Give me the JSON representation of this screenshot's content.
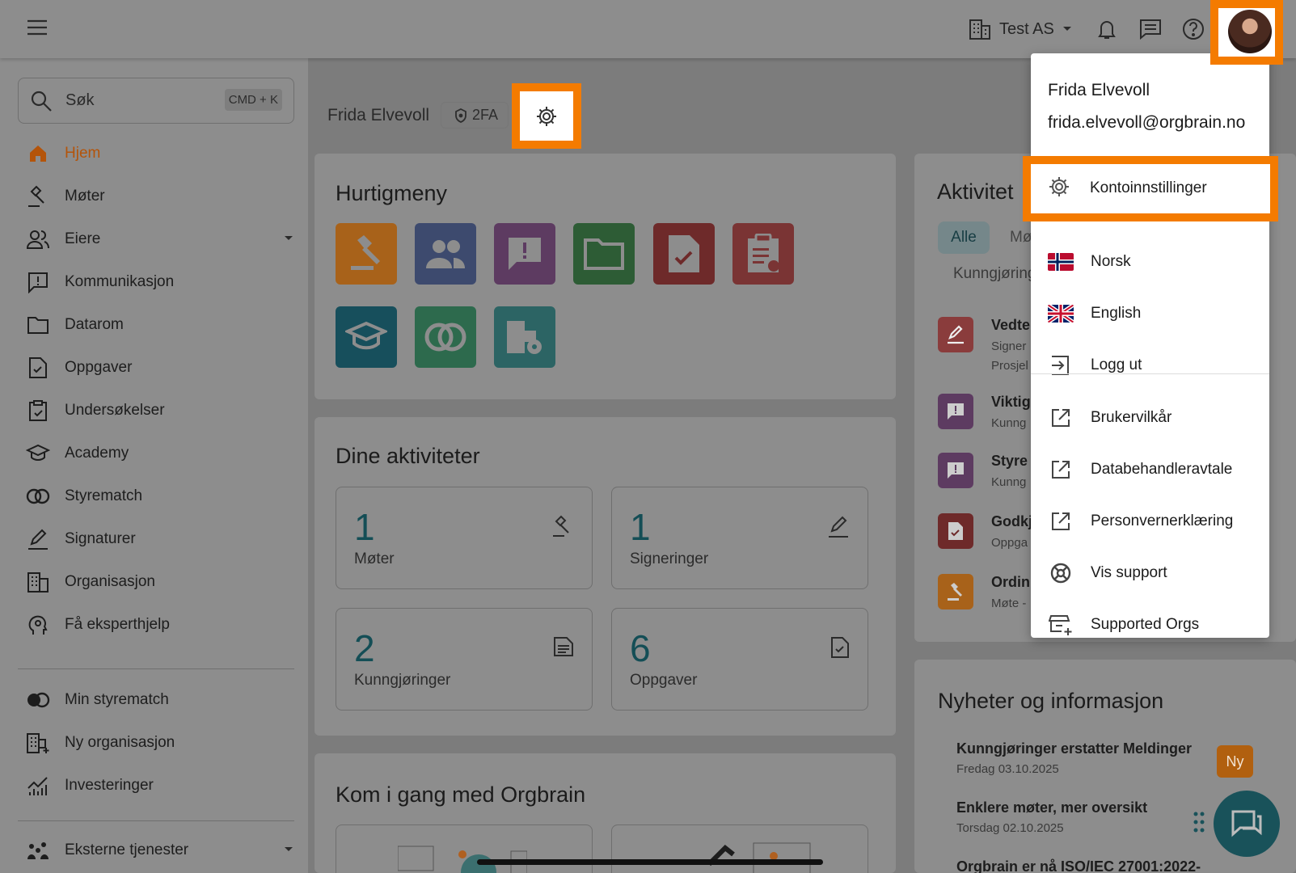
{
  "topbar": {
    "org_name": "Test AS"
  },
  "search": {
    "placeholder": "Søk",
    "shortcut": "CMD + K"
  },
  "sidebar": {
    "items": [
      {
        "label": "Hjem"
      },
      {
        "label": "Møter"
      },
      {
        "label": "Eiere"
      },
      {
        "label": "Kommunikasjon"
      },
      {
        "label": "Datarom"
      },
      {
        "label": "Oppgaver"
      },
      {
        "label": "Undersøkelser"
      },
      {
        "label": "Academy"
      },
      {
        "label": "Styrematch"
      },
      {
        "label": "Signaturer"
      },
      {
        "label": "Organisasjon"
      },
      {
        "label": "Få eksperthjelp"
      }
    ],
    "secondary": [
      {
        "label": "Min styrematch"
      },
      {
        "label": "Ny organisasjon"
      },
      {
        "label": "Investeringer"
      }
    ],
    "external": {
      "label": "Eksterne tjenester"
    }
  },
  "profile": {
    "name": "Frida Elvevoll",
    "badge": "2FA"
  },
  "quickmenu": {
    "title": "Hurtigmeny"
  },
  "activities": {
    "title": "Dine aktiviteter",
    "stats": [
      {
        "value": "1",
        "label": "Møter"
      },
      {
        "value": "1",
        "label": "Signeringer"
      },
      {
        "value": "2",
        "label": "Kunngjøringer"
      },
      {
        "value": "6",
        "label": "Oppgaver"
      }
    ]
  },
  "getting_started": {
    "title": "Kom i gang med Orgbrain"
  },
  "activity_feed": {
    "title": "Aktivitet",
    "filter_all": "Alle",
    "filter_meetings": "Mø",
    "filter_announcements": "Kunngjøring",
    "rows": [
      {
        "title": "Vedte",
        "sub": "Signer",
        "sub2": "Prosjel"
      },
      {
        "title": "Viktig",
        "sub": "Kunng"
      },
      {
        "title": "Styre",
        "sub": "Kunng"
      },
      {
        "title": "Godkj",
        "sub": "Oppga"
      },
      {
        "title": "Ordin",
        "sub": "Møte -"
      }
    ]
  },
  "news": {
    "title": "Nyheter og informasjon",
    "new_badge": "Ny",
    "items": [
      {
        "title": "Kunngjøringer erstatter Meldinger",
        "date": "Fredag 03.10.2025"
      },
      {
        "title": "Enklere møter, mer oversikt",
        "date": "Torsdag 02.10.2025"
      },
      {
        "title": "Orgbrain er nå ISO/IEC 27001:2022-"
      }
    ]
  },
  "user_menu": {
    "name": "Frida Elvevoll",
    "email": "frida.elvevoll@orgbrain.no",
    "items": [
      {
        "label": "Kontoinnstillinger",
        "icon": "gear-icon"
      },
      {
        "label": "Norsk",
        "icon": "norway-flag-icon"
      },
      {
        "label": "English",
        "icon": "uk-flag-icon"
      },
      {
        "label": "Logg ut",
        "icon": "logout-icon"
      },
      {
        "label": "Brukervilkår",
        "icon": "external-link-icon"
      },
      {
        "label": "Databehandleravtale",
        "icon": "external-link-icon"
      },
      {
        "label": "Personvernerklæring",
        "icon": "external-link-icon"
      },
      {
        "label": "Vis support",
        "icon": "lifebuoy-icon"
      },
      {
        "label": "Supported Orgs",
        "icon": "store-add-icon"
      }
    ]
  },
  "colors": {
    "highlight": "#f47b00",
    "primary": "#19525a",
    "active_nav": "#b4540a"
  }
}
